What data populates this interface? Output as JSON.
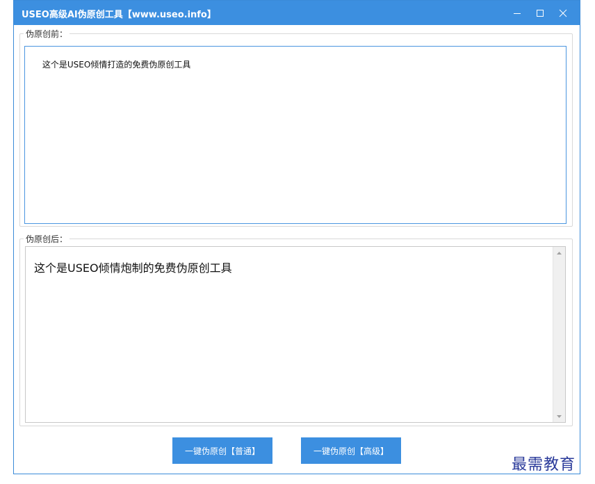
{
  "window": {
    "title": "USEO高级AI伪原创工具【www.useo.info】"
  },
  "input_group": {
    "legend": "伪原创前：",
    "value": "这个是USEO倾情打造的免费伪原创工具"
  },
  "output_group": {
    "legend": "伪原创后：",
    "value": "这个是USEO倾情炮制的免费伪原创工具"
  },
  "buttons": {
    "normal_label": "一键伪原创【普通】",
    "advanced_label": "一键伪原创【高级】"
  },
  "watermark": {
    "text": "最需教育"
  },
  "colors": {
    "accent": "#3c8fe0",
    "input_border": "#4a95e0",
    "watermark": "#2a3a9a"
  }
}
